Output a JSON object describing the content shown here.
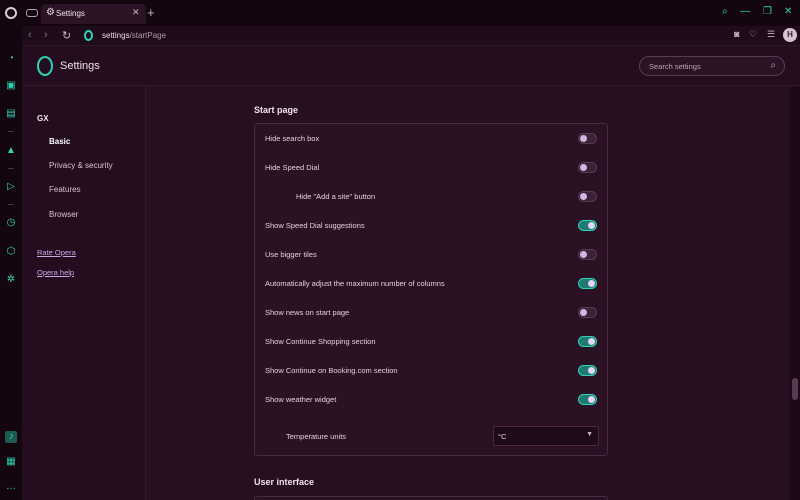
{
  "tab": {
    "title": "Settings"
  },
  "address": {
    "host": "settings",
    "path": "/startPage"
  },
  "avatar_letter": "H",
  "header": {
    "title": "Settings",
    "search_placeholder": "Search settings"
  },
  "nav": {
    "section": "GX",
    "items": [
      {
        "label": "Basic",
        "active": true
      },
      {
        "label": "Privacy & security",
        "active": false
      },
      {
        "label": "Features",
        "active": false
      },
      {
        "label": "Browser",
        "active": false
      }
    ],
    "links": [
      "Rate Opera",
      "Opera help"
    ]
  },
  "start_page": {
    "title": "Start page",
    "rows": [
      {
        "label": "Hide search box",
        "on": false
      },
      {
        "label": "Hide Speed Dial",
        "on": false
      },
      {
        "label": "Hide \"Add a site\" button",
        "on": false
      },
      {
        "label": "Show Speed Dial suggestions",
        "on": true
      },
      {
        "label": "Use bigger tiles",
        "on": false
      },
      {
        "label": "Automatically adjust the maximum number of columns",
        "on": true
      },
      {
        "label": "Show news on start page",
        "on": false
      },
      {
        "label": "Show Continue Shopping section",
        "on": true
      },
      {
        "label": "Show Continue on Booking.com section",
        "on": true
      },
      {
        "label": "Show weather widget",
        "on": true
      }
    ],
    "temperature_label": "Temperature units",
    "temperature_value": "°C"
  },
  "user_interface": {
    "title": "User interface"
  },
  "colors": {
    "accent": "#2fd3b5",
    "background": "#260f21",
    "toggle_on": "#1e7a72"
  }
}
